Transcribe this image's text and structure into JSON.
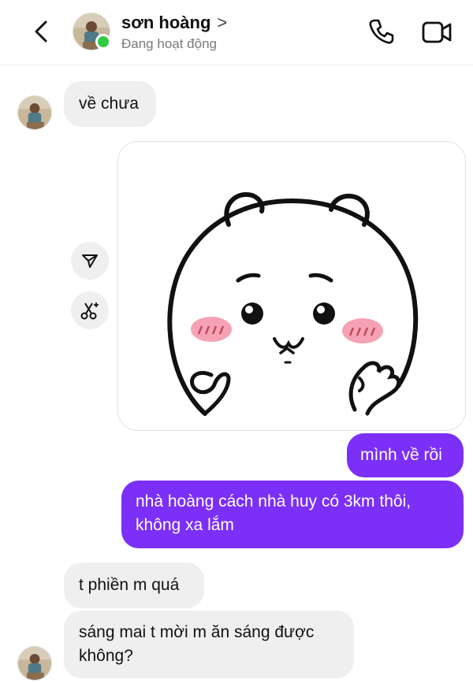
{
  "header": {
    "contact_name": "sơn hoàng",
    "name_chevron": ">",
    "status": "Đang hoạt động"
  },
  "messages": [
    {
      "id": "m1",
      "direction": "incoming",
      "text": "về chưa"
    },
    {
      "id": "m2",
      "direction": "incoming",
      "type": "sticker",
      "sticker": "white-bear-blushing"
    },
    {
      "id": "m3",
      "direction": "outgoing",
      "text": "mình về rồi"
    },
    {
      "id": "m4",
      "direction": "outgoing",
      "text": "nhà hoàng cách nhà huy có 3km thôi, không xa lắm"
    },
    {
      "id": "m5",
      "direction": "incoming",
      "text": "t phiền m quá"
    },
    {
      "id": "m6",
      "direction": "incoming",
      "text": "sáng mai t mời m ăn sáng được không?"
    }
  ],
  "colors": {
    "outgoing_bubble": "#7b2ff7",
    "incoming_bubble": "#efefef",
    "online_dot": "#2ecc40",
    "sticker_blush": "#f5a3b4"
  },
  "icons": {
    "back": "chevron-left-icon",
    "call": "phone-icon",
    "video": "video-camera-icon",
    "forward": "send-icon",
    "cutout": "scissors-sparkle-icon"
  }
}
